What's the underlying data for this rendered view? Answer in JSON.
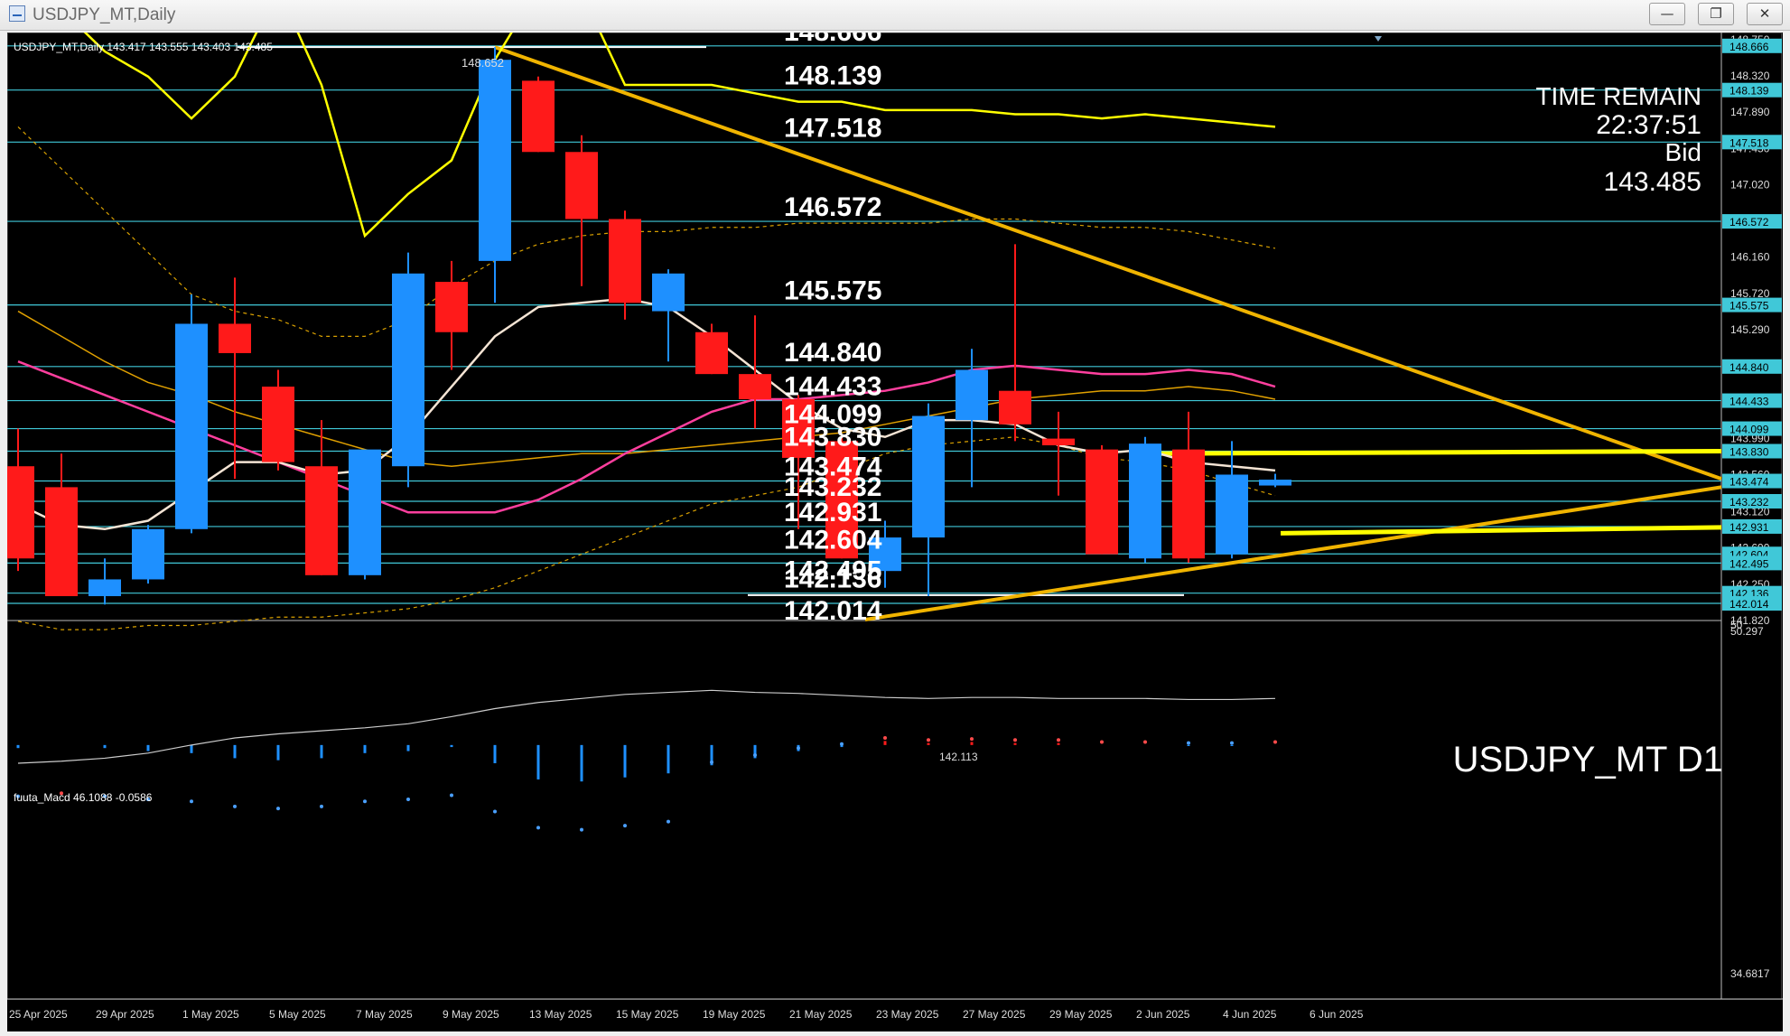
{
  "window": {
    "title": "USDJPY_MT,Daily",
    "buttons": {
      "minimize_icon": "minimize-icon",
      "restore_icon": "restore-icon",
      "close_icon": "close-icon"
    }
  },
  "chart": {
    "header": "USDJPY_MT,Daily  143.417 143.555 143.403 143.485",
    "watermark": "USDJPY_MT D1",
    "info": {
      "line1": "TIME REMAIN",
      "line2": "22:37:51",
      "line3": "Bid",
      "line4": "143.485"
    },
    "peak_label": "148.652",
    "low_label": "142.113",
    "level_labels": [
      "148.666",
      "148.139",
      "147.518",
      "146.572",
      "145.575",
      "144.840",
      "144.433",
      "144.099",
      "143.830",
      "143.474",
      "143.232",
      "142.931",
      "142.604",
      "142.495",
      "142.136",
      "142.014"
    ],
    "right_tag_labels": [
      "148.666",
      "148.139",
      "147.518",
      "146.572",
      "145.575",
      "144.840",
      "144.433",
      "144.099",
      "143.830",
      "143.474",
      "143.232",
      "142.931",
      "142.604",
      "142.495",
      "142.136",
      "142.014"
    ],
    "price_axis_labels": [
      "148.750",
      "148.320",
      "147.890",
      "147.450",
      "147.020",
      "146.590",
      "146.160",
      "145.720",
      "145.290",
      "144.860",
      "144.420",
      "143.990",
      "143.560",
      "143.120",
      "142.690",
      "142.250",
      "141.820"
    ],
    "date_labels": [
      "25 Apr 2025",
      "29 Apr 2025",
      "1 May 2025",
      "5 May 2025",
      "7 May 2025",
      "9 May 2025",
      "13 May 2025",
      "15 May 2025",
      "19 May 2025",
      "21 May 2025",
      "23 May 2025",
      "27 May 2025",
      "29 May 2025",
      "2 Jun 2025",
      "4 Jun 2025",
      "6 Jun 2025"
    ],
    "macd": {
      "title": "fuuta_Macd 46.1088  -0.0586",
      "axis_top": "50.297",
      "axis_top2": "50",
      "axis_bottom": "34.6817"
    },
    "colors": {
      "bull": "#1e90ff",
      "bear": "#ff1a1a",
      "level": "#40c8d8",
      "trend": "#f0b400",
      "yellow": "#ffff00",
      "pink": "#ff3f9e",
      "white": "#ffffff"
    }
  },
  "chart_data": {
    "type": "candlestick",
    "symbol": "USDJPY_MT",
    "timeframe": "Daily",
    "ohlc": [
      {
        "o": 143.65,
        "h": 144.1,
        "l": 142.4,
        "c": 142.55
      },
      {
        "o": 143.4,
        "h": 143.8,
        "l": 142.1,
        "c": 142.1
      },
      {
        "o": 142.1,
        "h": 142.55,
        "l": 142.0,
        "c": 142.3
      },
      {
        "o": 142.3,
        "h": 142.95,
        "l": 142.25,
        "c": 142.9
      },
      {
        "o": 142.9,
        "h": 145.7,
        "l": 142.85,
        "c": 145.35
      },
      {
        "o": 145.35,
        "h": 145.9,
        "l": 143.5,
        "c": 145.0
      },
      {
        "o": 144.6,
        "h": 144.8,
        "l": 143.6,
        "c": 143.7
      },
      {
        "o": 143.65,
        "h": 144.2,
        "l": 142.35,
        "c": 142.35
      },
      {
        "o": 142.35,
        "h": 143.85,
        "l": 142.3,
        "c": 143.85
      },
      {
        "o": 143.65,
        "h": 146.2,
        "l": 143.4,
        "c": 145.95
      },
      {
        "o": 145.85,
        "h": 146.1,
        "l": 144.8,
        "c": 145.25
      },
      {
        "o": 146.1,
        "h": 148.65,
        "l": 145.6,
        "c": 148.5
      },
      {
        "o": 148.25,
        "h": 148.3,
        "l": 147.4,
        "c": 147.4
      },
      {
        "o": 147.4,
        "h": 147.6,
        "l": 145.8,
        "c": 146.6
      },
      {
        "o": 146.6,
        "h": 146.7,
        "l": 145.4,
        "c": 145.6
      },
      {
        "o": 145.5,
        "h": 146.0,
        "l": 144.9,
        "c": 145.95
      },
      {
        "o": 145.25,
        "h": 145.35,
        "l": 144.75,
        "c": 144.75
      },
      {
        "o": 144.75,
        "h": 145.45,
        "l": 144.1,
        "c": 144.45
      },
      {
        "o": 144.45,
        "h": 144.5,
        "l": 142.9,
        "c": 143.75
      },
      {
        "o": 143.95,
        "h": 144.0,
        "l": 142.55,
        "c": 142.55
      },
      {
        "o": 142.4,
        "h": 143.0,
        "l": 142.2,
        "c": 142.8
      },
      {
        "o": 142.8,
        "h": 144.4,
        "l": 142.1,
        "c": 144.25
      },
      {
        "o": 144.2,
        "h": 145.05,
        "l": 143.4,
        "c": 144.8
      },
      {
        "o": 144.55,
        "h": 146.3,
        "l": 143.95,
        "c": 144.15
      },
      {
        "o": 143.98,
        "h": 144.3,
        "l": 143.3,
        "c": 143.9
      },
      {
        "o": 143.85,
        "h": 143.9,
        "l": 142.6,
        "c": 142.6
      },
      {
        "o": 142.55,
        "h": 144.0,
        "l": 142.5,
        "c": 143.92
      },
      {
        "o": 143.85,
        "h": 144.3,
        "l": 142.5,
        "c": 142.55
      },
      {
        "o": 142.6,
        "h": 143.95,
        "l": 142.55,
        "c": 143.55
      },
      {
        "o": 143.42,
        "h": 143.56,
        "l": 143.4,
        "c": 143.49
      }
    ],
    "ma_white": [
      143.2,
      142.95,
      142.9,
      143.0,
      143.35,
      143.7,
      143.7,
      143.55,
      143.6,
      144.0,
      144.6,
      145.2,
      145.55,
      145.6,
      145.65,
      145.55,
      145.2,
      144.8,
      144.4,
      144.1,
      144.0,
      144.2,
      144.2,
      144.15,
      143.9,
      143.8,
      143.85,
      143.7,
      143.65,
      143.6
    ],
    "ma_pink": [
      144.9,
      144.7,
      144.5,
      144.3,
      144.1,
      143.9,
      143.7,
      143.5,
      143.3,
      143.1,
      143.1,
      143.1,
      143.25,
      143.5,
      143.8,
      144.05,
      144.3,
      144.45,
      144.45,
      144.5,
      144.55,
      144.65,
      144.8,
      144.85,
      144.8,
      144.75,
      144.75,
      144.8,
      144.75,
      144.6
    ],
    "ma_yellow": [
      149.5,
      149.1,
      148.6,
      148.3,
      147.8,
      148.3,
      149.5,
      148.2,
      146.4,
      146.9,
      147.3,
      148.5,
      149.5,
      149.3,
      148.2,
      148.2,
      148.2,
      148.1,
      148.0,
      148.0,
      147.9,
      147.9,
      147.9,
      147.85,
      147.85,
      147.8,
      147.85,
      147.8,
      147.75,
      147.7
    ],
    "ma_orange": [
      145.5,
      145.2,
      144.9,
      144.65,
      144.5,
      144.3,
      144.15,
      144.0,
      143.85,
      143.7,
      143.65,
      143.7,
      143.75,
      143.8,
      143.8,
      143.85,
      143.9,
      143.95,
      144.0,
      144.05,
      144.15,
      144.25,
      144.35,
      144.45,
      144.5,
      144.55,
      144.55,
      144.6,
      144.55,
      144.45
    ],
    "band_upper": [
      147.7,
      147.2,
      146.7,
      146.2,
      145.7,
      145.5,
      145.4,
      145.2,
      145.2,
      145.4,
      145.8,
      146.1,
      146.3,
      146.4,
      146.45,
      146.45,
      146.5,
      146.5,
      146.55,
      146.55,
      146.55,
      146.55,
      146.6,
      146.6,
      146.55,
      146.5,
      146.5,
      146.45,
      146.35,
      146.25
    ],
    "band_lower": [
      141.8,
      141.7,
      141.7,
      141.75,
      141.75,
      141.8,
      141.85,
      141.85,
      141.9,
      141.95,
      142.05,
      142.2,
      142.4,
      142.6,
      142.8,
      143.0,
      143.2,
      143.3,
      143.4,
      143.6,
      143.8,
      143.9,
      143.95,
      144.0,
      143.9,
      143.75,
      143.7,
      143.6,
      143.45,
      143.3
    ],
    "levels": [
      148.666,
      148.139,
      147.518,
      146.572,
      145.575,
      144.84,
      144.433,
      144.099,
      143.83,
      143.474,
      143.232,
      142.931,
      142.604,
      142.495,
      142.136,
      142.014
    ],
    "macd_histogram": [
      38.5,
      38.8,
      38.5,
      38.2,
      38.0,
      37.5,
      37.3,
      37.5,
      38.0,
      38.2,
      38.6,
      37.0,
      35.4,
      35.2,
      35.6,
      36.0,
      36.8,
      37.5,
      38.2,
      38.6,
      39.2,
      39.0,
      39.1,
      39.0,
      39.0,
      38.8,
      38.8,
      38.7,
      38.7,
      38.8
    ],
    "macd_signal": [
      37.0,
      37.2,
      37.5,
      38.0,
      38.8,
      39.5,
      39.9,
      40.2,
      40.5,
      40.9,
      41.6,
      42.4,
      43.0,
      43.4,
      43.8,
      44.0,
      44.2,
      44.0,
      43.9,
      43.7,
      43.5,
      43.4,
      43.5,
      43.5,
      43.4,
      43.4,
      43.4,
      43.3,
      43.3,
      43.4
    ],
    "ylim": [
      141.82,
      148.75
    ],
    "macd_ylim": [
      34.6817,
      50.297
    ]
  }
}
